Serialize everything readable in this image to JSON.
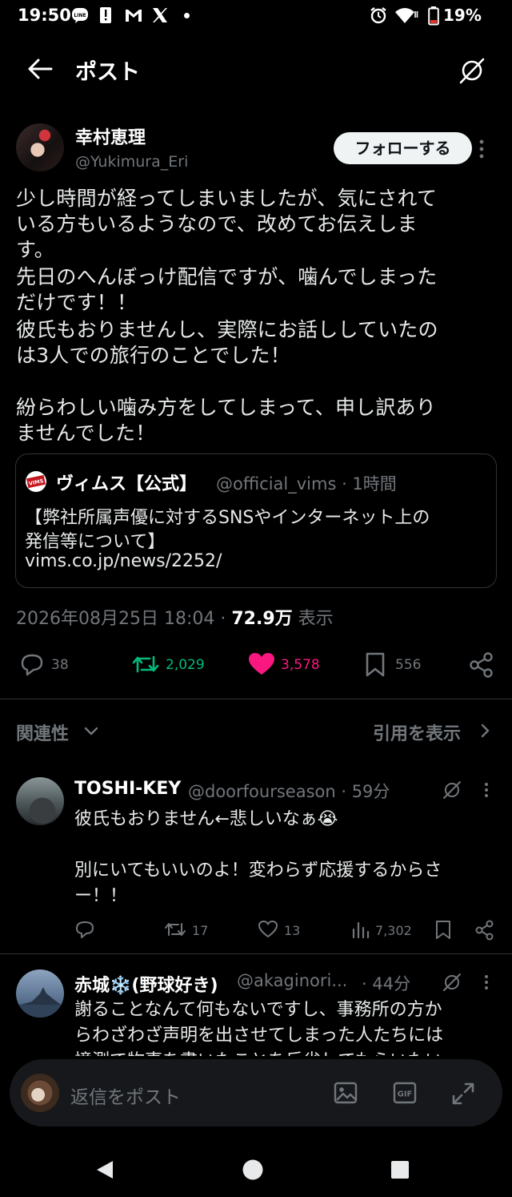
{
  "status_bar": {
    "time": "19:50",
    "line_icon_text": "LINE",
    "battery": "19%"
  },
  "header": {
    "title": "ポスト"
  },
  "post": {
    "author_name": "幸村恵理",
    "author_handle": "@Yukimura_Eri",
    "follow_label": "フォローする",
    "lines": [
      "少し時間が経ってしまいましたが、気にされて",
      "いる方もいるようなので、改めてお伝えしま",
      "す。",
      "先日のへんぼっけ配信ですが、噛んでしまった",
      "だけです！！",
      "彼氏もおりませんし、実際にお話ししていたの",
      "は3人での旅行のことでした！",
      "紛らわしい噛み方をしてしまって、申し訳あり",
      "ませんでした！"
    ],
    "quote": {
      "name": "ヴィムス【公式】",
      "meta": "@official_vims · 1時間",
      "logo_text": "VIMS",
      "lines": [
        "【弊社所属声優に対するSNSやインターネット上の",
        "発信等について】",
        "vims.co.jp/news/2252/"
      ]
    },
    "datetime": "2026年08月25日 18:04 · ",
    "views": "72.9万",
    "views_label": " 表示",
    "stats": {
      "replies": "38",
      "reposts": "2,029",
      "likes": "3,578",
      "bookmarks": "556"
    }
  },
  "sort": {
    "label": "関連性",
    "quotes_link": "引用を表示"
  },
  "replies": [
    {
      "name": "TOSHI-KEY",
      "meta": "@doorfourseason · 59分",
      "lines": [
        "彼氏もおりません←悲しいなぁ😭",
        "",
        "別にいてもいいのよ！変わらず応援するからさ",
        "ー！！"
      ],
      "replies": "",
      "reposts": "17",
      "likes": "13",
      "views": "7,302"
    },
    {
      "name": "赤城❄️(野球好き)",
      "handle": "@akaginori...",
      "time": "· 44分",
      "lines": [
        "謝ることなんて何もないですし、事務所の方か",
        "らわざわざ声明を出させてしまった人たちには",
        "憶測で物事を書いたことを反省してもらいたい"
      ]
    }
  ],
  "composer": {
    "placeholder": "返信をポスト",
    "gif_label": "GIF"
  },
  "colors": {
    "background": "#000000",
    "text": "#e7e9ea",
    "muted": "#71767b",
    "repost_active": "#00ba7c",
    "like_active": "#f91880",
    "divider": "#2f3336"
  }
}
